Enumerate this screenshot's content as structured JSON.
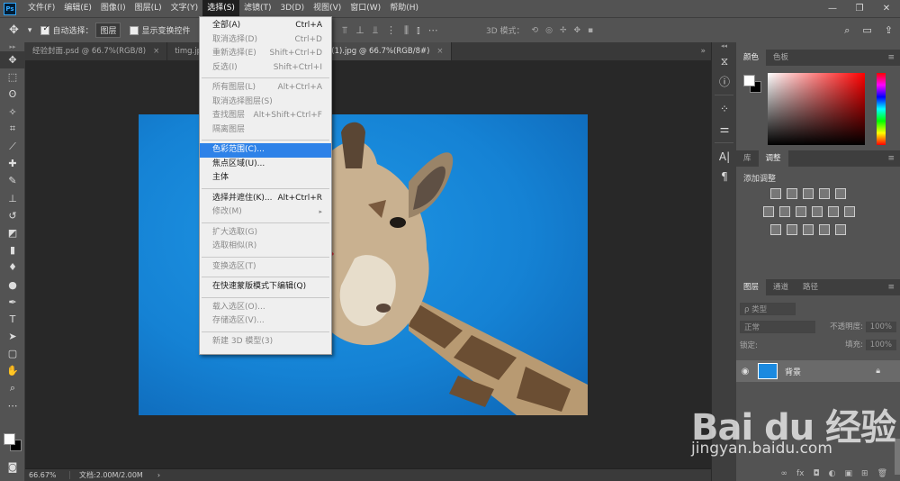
{
  "app": {
    "logo_text": "Ps",
    "menu": [
      "文件(F)",
      "编辑(E)",
      "图像(I)",
      "图层(L)",
      "文字(Y)",
      "选择(S)",
      "滤镜(T)",
      "3D(D)",
      "视图(V)",
      "窗口(W)",
      "帮助(H)"
    ],
    "window_buttons": [
      "—",
      "❐",
      "✕"
    ]
  },
  "options": {
    "move_icon": "move-tool-icon",
    "auto_select_label": "自动选择：",
    "auto_select_value": "图层",
    "show_transform_label": "显示变换控件",
    "mode_3d_label": "3D 模式："
  },
  "tabs": [
    {
      "label": "经验封面.psd @ 66.7%(RGB/8)",
      "close": "×"
    },
    {
      "label": "timg.jpg",
      "close": ""
    },
    {
      "label": "timg (1).jpg @ 66.7%(RGB/8#)",
      "close": "×"
    }
  ],
  "tabs_more": "»",
  "select_menu": {
    "items": [
      {
        "label": "全部(A)",
        "shortcut": "Ctrl+A",
        "disabled": false
      },
      {
        "label": "取消选择(D)",
        "shortcut": "Ctrl+D",
        "disabled": true
      },
      {
        "label": "重新选择(E)",
        "shortcut": "Shift+Ctrl+D",
        "disabled": true
      },
      {
        "label": "反选(I)",
        "shortcut": "Shift+Ctrl+I",
        "disabled": true
      },
      {
        "sep": true
      },
      {
        "label": "所有图层(L)",
        "shortcut": "Alt+Ctrl+A",
        "disabled": true
      },
      {
        "label": "取消选择图层(S)",
        "shortcut": "",
        "disabled": true
      },
      {
        "label": "查找图层",
        "shortcut": "Alt+Shift+Ctrl+F",
        "disabled": true
      },
      {
        "label": "隔离图层",
        "shortcut": "",
        "disabled": true
      },
      {
        "sep": true
      },
      {
        "label": "色彩范围(C)...",
        "shortcut": "",
        "disabled": false,
        "highlight": true
      },
      {
        "label": "焦点区域(U)...",
        "shortcut": "",
        "disabled": false
      },
      {
        "label": "主体",
        "shortcut": "",
        "disabled": false
      },
      {
        "sep": true
      },
      {
        "label": "选择并遮住(K)...",
        "shortcut": "Alt+Ctrl+R",
        "disabled": false
      },
      {
        "label": "修改(M)",
        "shortcut": "▸",
        "disabled": true
      },
      {
        "sep": true
      },
      {
        "label": "扩大选取(G)",
        "shortcut": "",
        "disabled": true
      },
      {
        "label": "选取相似(R)",
        "shortcut": "",
        "disabled": true
      },
      {
        "sep": true
      },
      {
        "label": "变换选区(T)",
        "shortcut": "",
        "disabled": true
      },
      {
        "sep": true
      },
      {
        "label": "在快速蒙版模式下编辑(Q)",
        "shortcut": "",
        "disabled": false
      },
      {
        "sep": true
      },
      {
        "label": "载入选区(O)...",
        "shortcut": "",
        "disabled": true
      },
      {
        "label": "存储选区(V)...",
        "shortcut": "",
        "disabled": true
      },
      {
        "sep": true
      },
      {
        "label": "新建 3D 模型(3)",
        "shortcut": "",
        "disabled": true
      }
    ]
  },
  "status": {
    "zoom": "66.67%",
    "doc": "文档:2.00M/2.00M",
    "arrow": "›"
  },
  "panels": {
    "color_tabs": [
      "颜色",
      "色板"
    ],
    "adj_tabs": [
      "库",
      "调整"
    ],
    "adj_title": "添加调整",
    "layers_tabs": [
      "图层",
      "通道",
      "路径"
    ],
    "kind_label": "ρ 类型",
    "blend_mode": "正常",
    "opacity_label": "不透明度:",
    "opacity_value": "100%",
    "lock_label": "锁定:",
    "fill_label": "填充:",
    "fill_value": "100%",
    "layer_name": "背景",
    "bottom_icons": [
      "∞",
      "fx",
      "◘",
      "◐",
      "▣",
      "⊞",
      "🗑"
    ],
    "menu_glyph": "≡"
  },
  "watermark": {
    "logo": "Bai du 经验",
    "url": "jingyan.baidu.com"
  },
  "colors": {
    "highlight": "#2e82e8",
    "arrow": "#e8323c",
    "sky": "#1582d4"
  }
}
